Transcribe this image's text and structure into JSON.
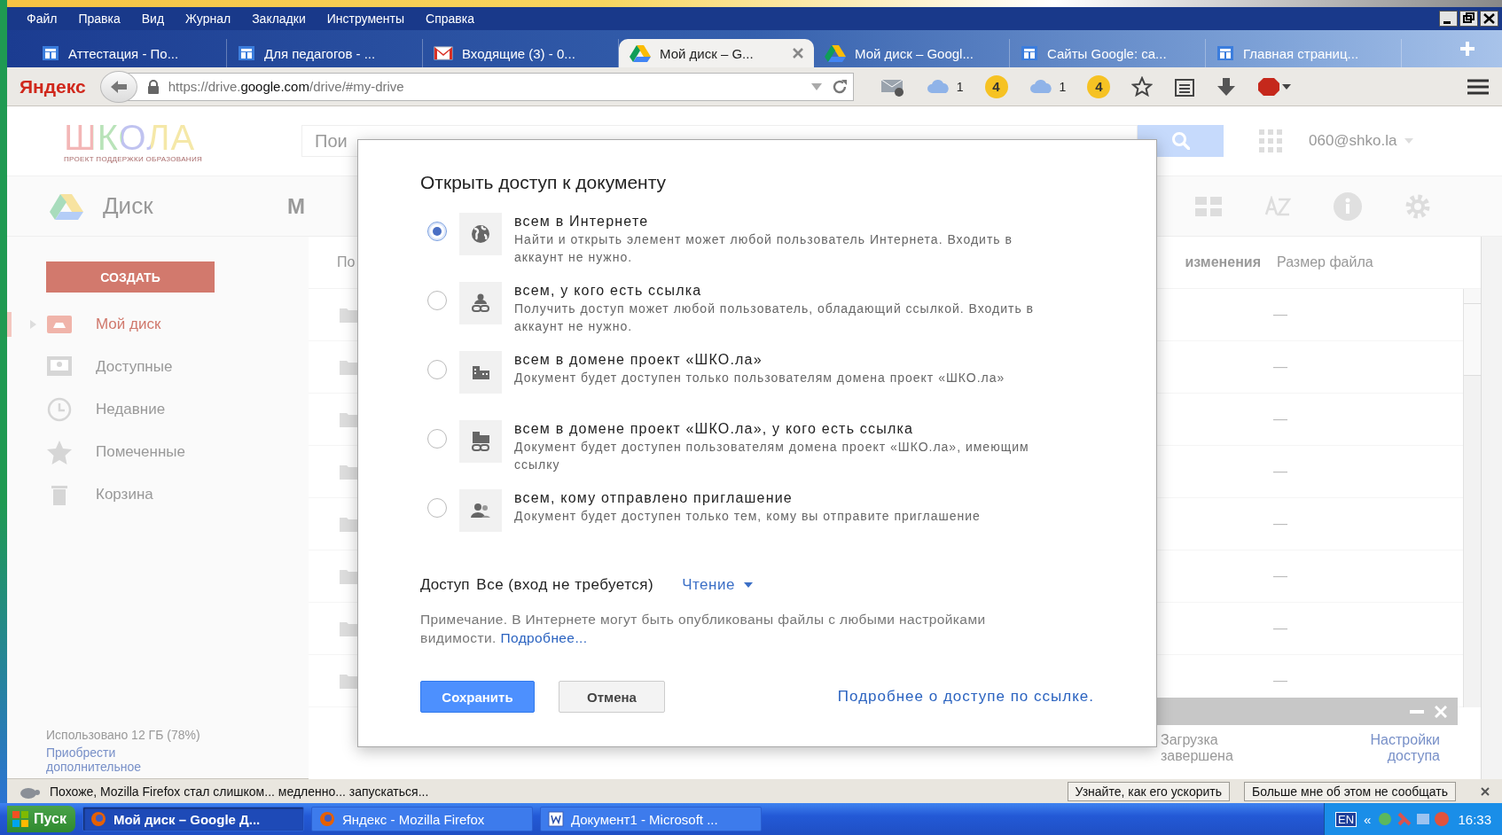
{
  "menu_bar": {
    "items": [
      "Файл",
      "Правка",
      "Вид",
      "Журнал",
      "Закладки",
      "Инструменты",
      "Справка"
    ]
  },
  "tabs": [
    {
      "label": "Аттестация - По...",
      "selected": false,
      "kind": "sites"
    },
    {
      "label": "Для педагогов - ...",
      "selected": false,
      "kind": "sites"
    },
    {
      "label": "Входящие (3) - 0...",
      "selected": false,
      "kind": "mail"
    },
    {
      "label": "Мой диск – G...",
      "selected": true,
      "kind": "drive"
    },
    {
      "label": "Мой диск – Googl...",
      "selected": false,
      "kind": "drive"
    },
    {
      "label": "Сайты Google: са...",
      "selected": false,
      "kind": "sites"
    },
    {
      "label": "Главная страниц...",
      "selected": false,
      "kind": "sites"
    }
  ],
  "address_bar": {
    "brand": "Яндекс",
    "url": "https://drive.**google.com**/drive/#my-drive"
  },
  "extensions": [
    {
      "kind": "cloud",
      "count": "1"
    },
    {
      "kind": "badge",
      "count": "4"
    },
    {
      "kind": "cloud",
      "count": "1"
    },
    {
      "kind": "badge",
      "count": "4"
    }
  ],
  "drive": {
    "logo": "ШКОЛА",
    "logo_subtitle": "ПРОЕКТ ПОДДЕРЖКИ ОБРАЗОВАНИЯ",
    "search_placeholder": "Пои",
    "account": "060@shko.la",
    "app_title": "Диск",
    "breadcrumb": "М",
    "create_button": "СОЗДАТЬ",
    "nav": [
      {
        "label": "Мой диск",
        "selected": true,
        "kind": "my-drive"
      },
      {
        "label": "Доступные",
        "selected": false,
        "kind": "shared"
      },
      {
        "label": "Недавние",
        "selected": false,
        "kind": "recent"
      },
      {
        "label": "Помеченные",
        "selected": false,
        "kind": "starred"
      },
      {
        "label": "Корзина",
        "selected": false,
        "kind": "trash"
      }
    ],
    "storage": "Использовано 12 ГБ (78%)",
    "storage_link": "Приобрести дополнительное",
    "columns": [
      "По",
      "изменения",
      "Размер файла"
    ],
    "rows": [
      {
        "size": "—"
      },
      {
        "size": "—"
      },
      {
        "size": "—"
      },
      {
        "size": "—"
      },
      {
        "size": "—"
      },
      {
        "size": "—"
      },
      {
        "size": "—"
      },
      {
        "size": "—"
      }
    ],
    "upload_panel": {
      "status": "Загрузка завершена",
      "link": "Настройки доступа"
    }
  },
  "dialog": {
    "title": "Открыть доступ к документу",
    "options": [
      {
        "title": "всем в Интернете",
        "description": "Найти и открыть элемент может любой пользователь Интернета. Входить в аккаунт не нужно.",
        "selected": true,
        "kind": "globe"
      },
      {
        "title": "всем, у кого есть ссылка",
        "description": "Получить доступ может любой пользователь, обладающий ссылкой. Входить в аккаунт не нужно.",
        "selected": false,
        "kind": "link"
      },
      {
        "title": "всем в домене проект «ШКО.ла»",
        "description": "Документ будет доступен только пользователям домена проект «ШКО.ла»",
        "selected": false,
        "kind": "domain"
      },
      {
        "title": "всем в домене проект «ШКО.ла», у кого есть ссылка",
        "description": "Документ будет доступен пользователям домена проект «ШКО.ла», имеющим ссылку",
        "selected": false,
        "kind": "domain-link"
      },
      {
        "title": "всем, кому отправлено приглашение",
        "description": "Документ будет доступен только тем, кому вы отправите приглашение",
        "selected": false,
        "kind": "people"
      }
    ],
    "access": {
      "label": "Доступ",
      "value": "Все (вход не требуется)",
      "permission": "Чтение"
    },
    "note": "Примечание. В Интернете могут быть опубликованы файлы с любыми настройками видимости.",
    "note_link": "Подробнее...",
    "buttons": [
      {
        "label": "Сохранить",
        "kind": "primary"
      },
      {
        "label": "Отмена",
        "kind": "secondary"
      }
    ],
    "help_link": "Подробнее о доступе по ссылке."
  },
  "notification": {
    "text": "Похоже, Mozilla Firefox стал слишком... медленно... запускаться...",
    "buttons": [
      "Узнайте, как его ускорить",
      "Больше мне об этом не сообщать"
    ]
  },
  "taskbar": {
    "start": "Пуск",
    "tasks": [
      {
        "label": "Мой диск – Google Д...",
        "selected": true,
        "kind": "firefox"
      },
      {
        "label": "Яндекс - Mozilla Firefox",
        "selected": false,
        "kind": "firefox"
      },
      {
        "label": "Документ1 - Microsoft ...",
        "selected": false,
        "kind": "word"
      }
    ],
    "language": "EN",
    "chevron": "«",
    "clock": "16:33"
  }
}
